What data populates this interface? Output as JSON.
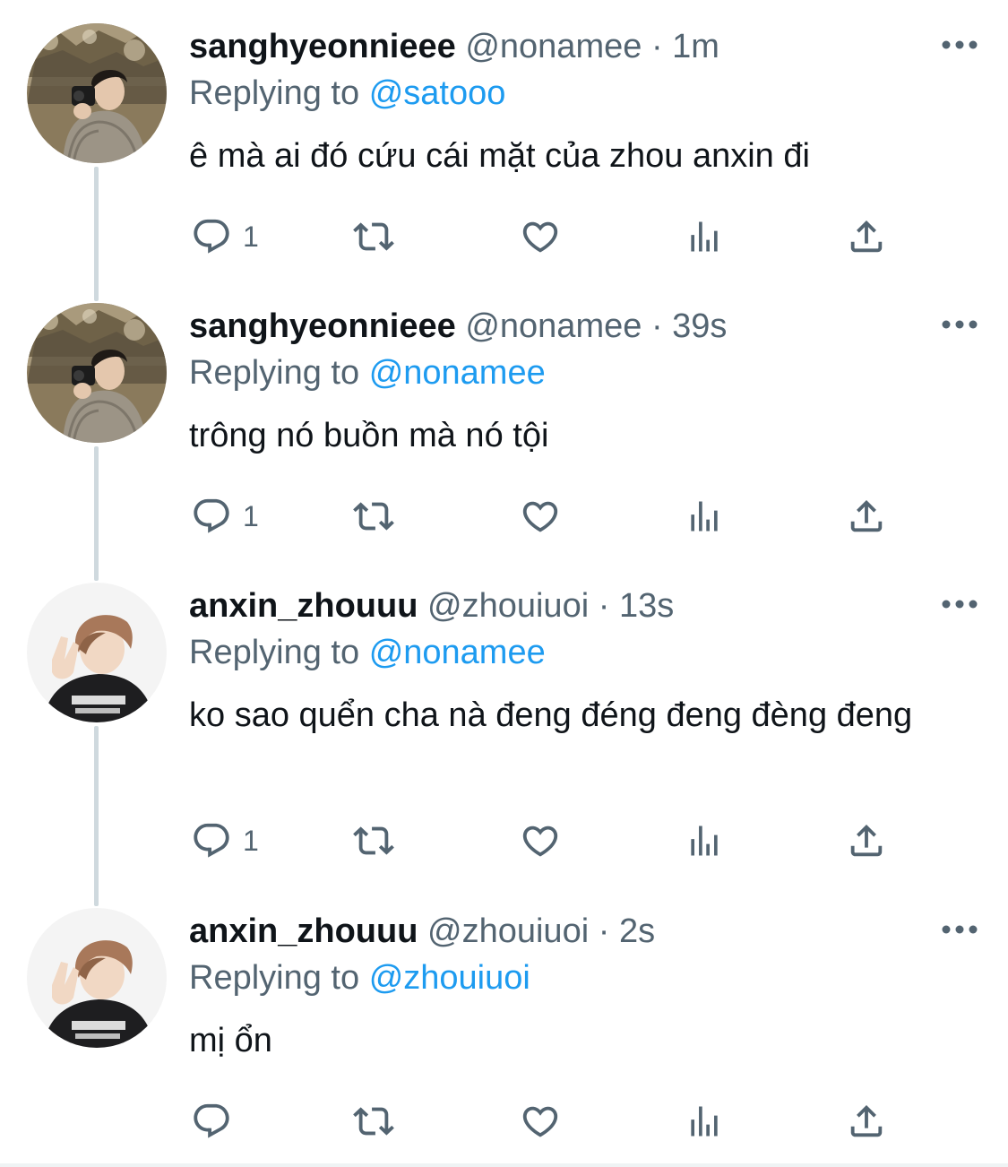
{
  "colors": {
    "text": "#0f1419",
    "secondary": "#536471",
    "accent": "#1d9bf0",
    "thread_line": "#cfd9de"
  },
  "icons": [
    "reply-icon",
    "retweet-icon",
    "like-icon",
    "views-icon",
    "share-icon",
    "more-icon"
  ],
  "tweets": [
    {
      "display_name": "sanghyeonnieee",
      "handle": "@nonamee",
      "separator": "·",
      "time": "1m",
      "replying_prefix": "Replying to",
      "replying_to": "@satooo",
      "text": "ê mà ai đó cứu cái mặt của zhou anxin đi",
      "reply_count": "1"
    },
    {
      "display_name": "sanghyeonnieee",
      "handle": "@nonamee",
      "separator": "·",
      "time": "39s",
      "replying_prefix": "Replying to",
      "replying_to": "@nonamee",
      "text": "trông nó buồn mà nó tội",
      "reply_count": "1"
    },
    {
      "display_name": "anxin_zhouuu",
      "handle": "@zhouiuoi",
      "separator": "·",
      "time": "13s",
      "replying_prefix": "Replying to",
      "replying_to": "@nonamee",
      "text": "ko sao quển cha nà đeng đéng đeng đèng đeng",
      "reply_count": "1"
    },
    {
      "display_name": "anxin_zhouuu",
      "handle": "@zhouiuoi",
      "separator": "·",
      "time": "2s",
      "replying_prefix": "Replying to",
      "replying_to": "@zhouiuoi",
      "text": "mị ổn",
      "reply_count": ""
    }
  ]
}
